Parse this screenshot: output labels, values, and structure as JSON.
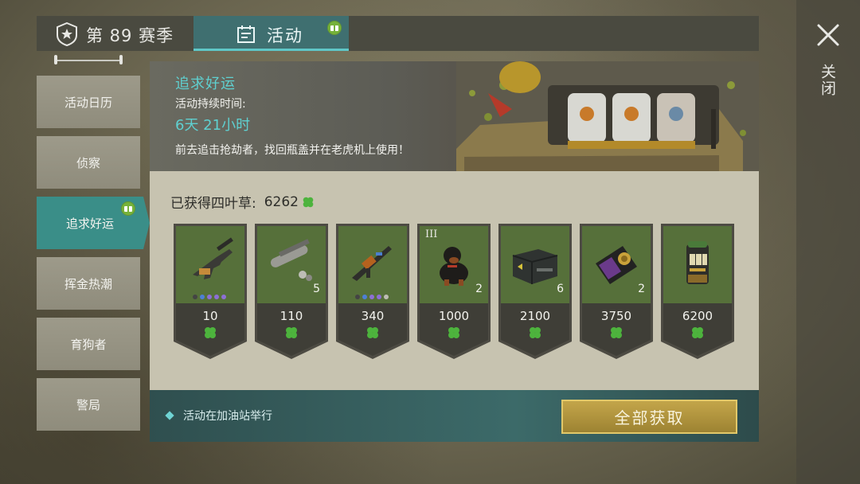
{
  "window": {
    "close_label": "关闭"
  },
  "tabs": {
    "season_label": "第 89 赛季",
    "activity_label": "活动"
  },
  "sidebar": {
    "items": [
      {
        "label": "活动日历",
        "active": false
      },
      {
        "label": "侦察",
        "active": false
      },
      {
        "label": "追求好运",
        "active": true,
        "has_gift_badge": true
      },
      {
        "label": "挥金热潮",
        "active": false
      },
      {
        "label": "育狗者",
        "active": false
      },
      {
        "label": "警局",
        "active": false
      }
    ]
  },
  "banner": {
    "title": "追求好运",
    "duration_label": "活动持续时间:",
    "duration_value": "6天 21小时",
    "description": "前去追击抢劫者，找回瓶盖并在老虎机上使用！"
  },
  "clover_count": {
    "label": "已获得四叶草:",
    "value": "6262"
  },
  "rewards": [
    {
      "item": "pistol-with-silencer",
      "cost": "10",
      "qty": "",
      "tier": "",
      "rarity_dots": [
        "dark",
        "blue",
        "purple",
        "purple",
        "purple"
      ]
    },
    {
      "item": "rocket-launcher-parts",
      "cost": "110",
      "qty": "5",
      "tier": "",
      "rarity_dots": []
    },
    {
      "item": "assault-rifle",
      "cost": "340",
      "qty": "",
      "tier": "",
      "rarity_dots": [
        "dark",
        "blue",
        "purple",
        "purple",
        "grey"
      ]
    },
    {
      "item": "rottweiler-dog",
      "cost": "1000",
      "qty": "2",
      "tier": "III",
      "rarity_dots": []
    },
    {
      "item": "military-crate",
      "cost": "2100",
      "qty": "6",
      "tier": "",
      "rarity_dots": []
    },
    {
      "item": "police-badge-wallet",
      "cost": "3750",
      "qty": "2",
      "tier": "",
      "rarity_dots": []
    },
    {
      "item": "slot-machine",
      "cost": "6200",
      "qty": "",
      "tier": "",
      "rarity_dots": []
    }
  ],
  "bottom_bar": {
    "note": "活动在加油站举行",
    "claim_all_label": "全部获取"
  },
  "colors": {
    "accent_teal": "#5fd0d0",
    "active_tab": "#3f6f70",
    "sidebar_active": "#3a8e88",
    "card_green": "#56703a",
    "clover_green": "#4db33d",
    "claim_gold": "#c3a54a"
  }
}
